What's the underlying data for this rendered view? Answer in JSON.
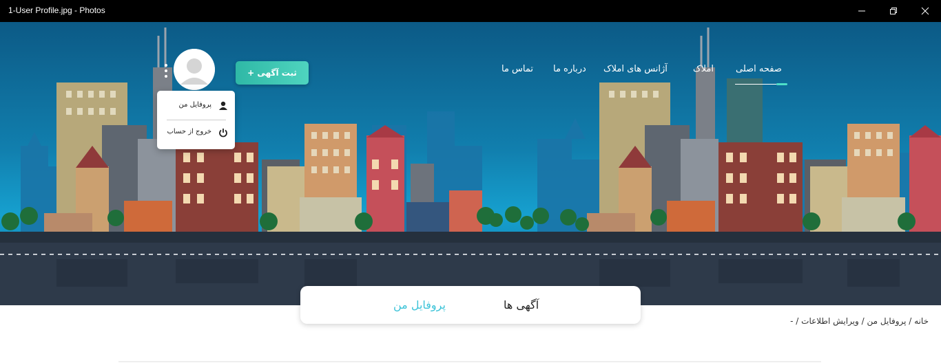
{
  "window": {
    "title": "1-User Profile.jpg - Photos"
  },
  "nav": {
    "items": [
      "صفحه اصلی",
      "املاک",
      "آژانس های املاک",
      "درباره ما",
      "تماس ما"
    ],
    "active_index": 0
  },
  "ad_button": {
    "label": "ثبت آگهی +"
  },
  "user_menu": {
    "items": [
      {
        "label": "پروفایل من",
        "icon": "user-icon"
      },
      {
        "label": "خروج از حساب",
        "icon": "power-icon"
      }
    ]
  },
  "tabs": {
    "items": [
      "آگهی ها",
      "پروفایل من"
    ],
    "active_index": 1
  },
  "breadcrumb": {
    "text": "خانه / پروفایل من / ویرایش اطلاعات / -"
  },
  "colors": {
    "accent": "#3cc3d8",
    "button": "#3fc6b2",
    "sky": "#117fae",
    "road": "#2e3a4a"
  }
}
